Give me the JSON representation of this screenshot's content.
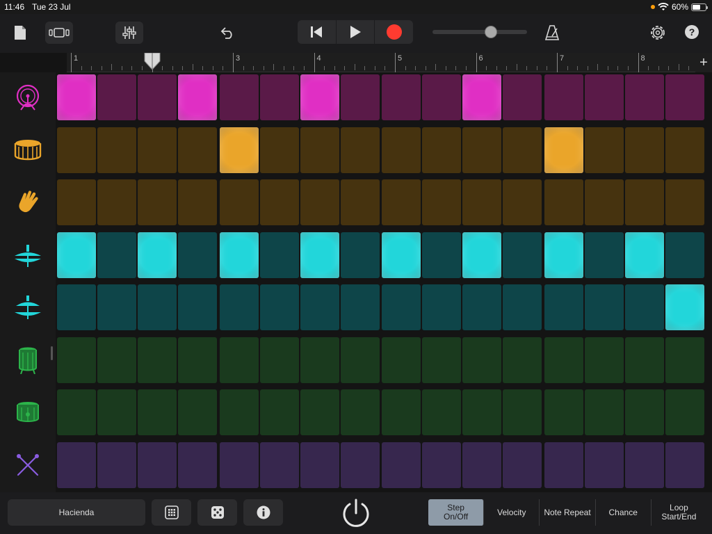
{
  "status": {
    "time": "11:46",
    "date": "Tue 23 Jul",
    "battery": "60%",
    "battery_level": 0.6
  },
  "toolbar": {
    "icons": [
      "document-icon",
      "view-toggle-icon",
      "mixer-icon",
      "undo-icon",
      "go-to-start-icon",
      "play-icon",
      "record-icon",
      "metronome-icon",
      "settings-icon",
      "help-icon"
    ],
    "volume_level": 0.62
  },
  "ruler": {
    "bars": [
      "1",
      "2",
      "3",
      "4",
      "5",
      "6",
      "7",
      "8"
    ],
    "playhead_bar": 2
  },
  "colors": {
    "magenta": {
      "on": "#e02fc4",
      "off": "#5a1a48"
    },
    "amber": {
      "on": "#eaa52a",
      "off": "#46330f"
    },
    "teal": {
      "on": "#22d6da",
      "off": "#0e4549"
    },
    "green": {
      "on": "#2cb44a",
      "off": "#1a3a1e"
    },
    "purple": {
      "on": "#8a5ce0",
      "off": "#37274e"
    }
  },
  "rows": [
    {
      "instrument": "kick-drum-icon",
      "color": "magenta",
      "steps": [
        1,
        0,
        0,
        1,
        0,
        0,
        1,
        0,
        0,
        0,
        1,
        0,
        0,
        0,
        0,
        0
      ]
    },
    {
      "instrument": "snare-drum-icon",
      "color": "amber",
      "steps": [
        0,
        0,
        0,
        0,
        1,
        0,
        0,
        0,
        0,
        0,
        0,
        0,
        1,
        0,
        0,
        0
      ]
    },
    {
      "instrument": "hand-clap-icon",
      "color": "amber",
      "steps": [
        0,
        0,
        0,
        0,
        0,
        0,
        0,
        0,
        0,
        0,
        0,
        0,
        0,
        0,
        0,
        0
      ]
    },
    {
      "instrument": "closed-hihat-icon",
      "color": "teal",
      "steps": [
        1,
        0,
        1,
        0,
        1,
        0,
        1,
        0,
        1,
        0,
        1,
        0,
        1,
        0,
        1,
        0
      ]
    },
    {
      "instrument": "open-hihat-icon",
      "color": "teal",
      "steps": [
        0,
        0,
        0,
        0,
        0,
        0,
        0,
        0,
        0,
        0,
        0,
        0,
        0,
        0,
        0,
        1
      ]
    },
    {
      "instrument": "low-tom-icon",
      "color": "green",
      "steps": [
        0,
        0,
        0,
        0,
        0,
        0,
        0,
        0,
        0,
        0,
        0,
        0,
        0,
        0,
        0,
        0
      ]
    },
    {
      "instrument": "high-tom-icon",
      "color": "green",
      "steps": [
        0,
        0,
        0,
        0,
        0,
        0,
        0,
        0,
        0,
        0,
        0,
        0,
        0,
        0,
        0,
        0
      ]
    },
    {
      "instrument": "drumsticks-icon",
      "color": "purple",
      "steps": [
        0,
        0,
        0,
        0,
        0,
        0,
        0,
        0,
        0,
        0,
        0,
        0,
        0,
        0,
        0,
        0
      ]
    }
  ],
  "bottom": {
    "pattern_name": "Hacienda",
    "buttons": [
      "pattern-grid-icon",
      "randomize-dice-icon",
      "info-icon",
      "power-icon"
    ],
    "modes": [
      "Step\nOn/Off",
      "Velocity",
      "Note Repeat",
      "Chance",
      "Loop\nStart/End"
    ],
    "active_mode": 0
  }
}
